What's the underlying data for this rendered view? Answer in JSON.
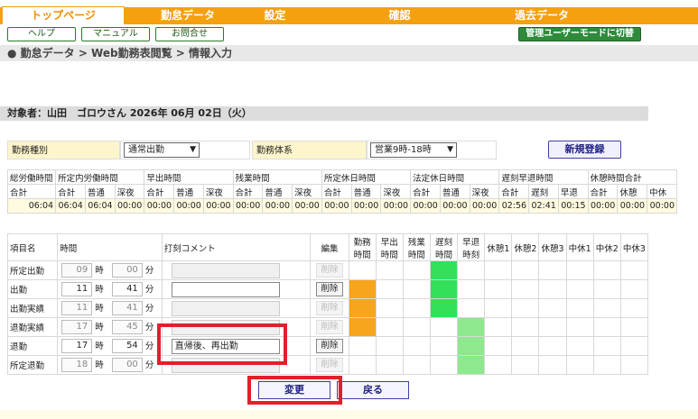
{
  "nav": {
    "tabs": [
      "トップページ",
      "勤怠データ",
      "設定",
      "確認",
      "過去データ"
    ]
  },
  "toolbar": {
    "help": "ヘルプ",
    "manual": "マニュアル",
    "contact": "お問合せ",
    "admin_mode": "管理ユーザーモードに切替"
  },
  "breadcrumb": "● 勤怠データ > Web勤務表閲覧 > 情報入力",
  "target": "対象者：山田　ゴロウさん 2026年 06月 02日（火）",
  "form": {
    "work_type_label": "勤務種別",
    "work_type_value": "通常出勤",
    "work_system_label": "勤務体系",
    "work_system_value": "営業9時-18時",
    "new_button": "新規登録"
  },
  "summary": {
    "groups": [
      "総労働時間",
      "所定内労働時間",
      "",
      "早出時間",
      "",
      "",
      "残業時間",
      "",
      "",
      "所定休日時間",
      "",
      "",
      "法定休日時間",
      "",
      "",
      "遅刻早退時間",
      "",
      "",
      "休憩時間合計",
      "",
      ""
    ],
    "sub": [
      "合計",
      "合計",
      "普通",
      "深夜",
      "合計",
      "普通",
      "深夜",
      "合計",
      "普通",
      "深夜",
      "合計",
      "普通",
      "深夜",
      "合計",
      "普通",
      "深夜",
      "合計",
      "遅刻",
      "早退",
      "合計",
      "休憩",
      "中休"
    ],
    "values": [
      "06:04",
      "06:04",
      "06:04",
      "00:00",
      "00:00",
      "00:00",
      "00:00",
      "00:00",
      "00:00",
      "00:00",
      "00:00",
      "00:00",
      "00:00",
      "00:00",
      "00:00",
      "00:00",
      "02:56",
      "02:41",
      "00:15",
      "00:00",
      "00:00",
      "00:00"
    ]
  },
  "detail": {
    "headers": {
      "item": "項目名",
      "time": "時間",
      "comment": "打刻コメント",
      "edit": "編集",
      "c1": "勤務時間",
      "c2": "早出時間",
      "c3": "残業時間",
      "c4": "遅刻時間",
      "c5": "早退時刻",
      "c6": "休憩1",
      "c7": "休憩2",
      "c8": "休憩3",
      "c9": "中休1",
      "c10": "中休2",
      "c11": "中休3"
    },
    "hour_unit": "時",
    "min_unit": "分",
    "delete": "削除",
    "rows": [
      {
        "name": "所定出勤",
        "h": "09",
        "m": "00",
        "comment": ""
      },
      {
        "name": "出勤",
        "h": "11",
        "m": "41",
        "comment": ""
      },
      {
        "name": "出勤実績",
        "h": "11",
        "m": "41",
        "comment": ""
      },
      {
        "name": "退勤実績",
        "h": "17",
        "m": "45",
        "comment": ""
      },
      {
        "name": "退勤",
        "h": "17",
        "m": "54",
        "comment": "直帰後、再出勤"
      },
      {
        "name": "所定退勤",
        "h": "18",
        "m": "00",
        "comment": ""
      }
    ]
  },
  "buttons": {
    "change": "変更",
    "back": "戻る"
  }
}
